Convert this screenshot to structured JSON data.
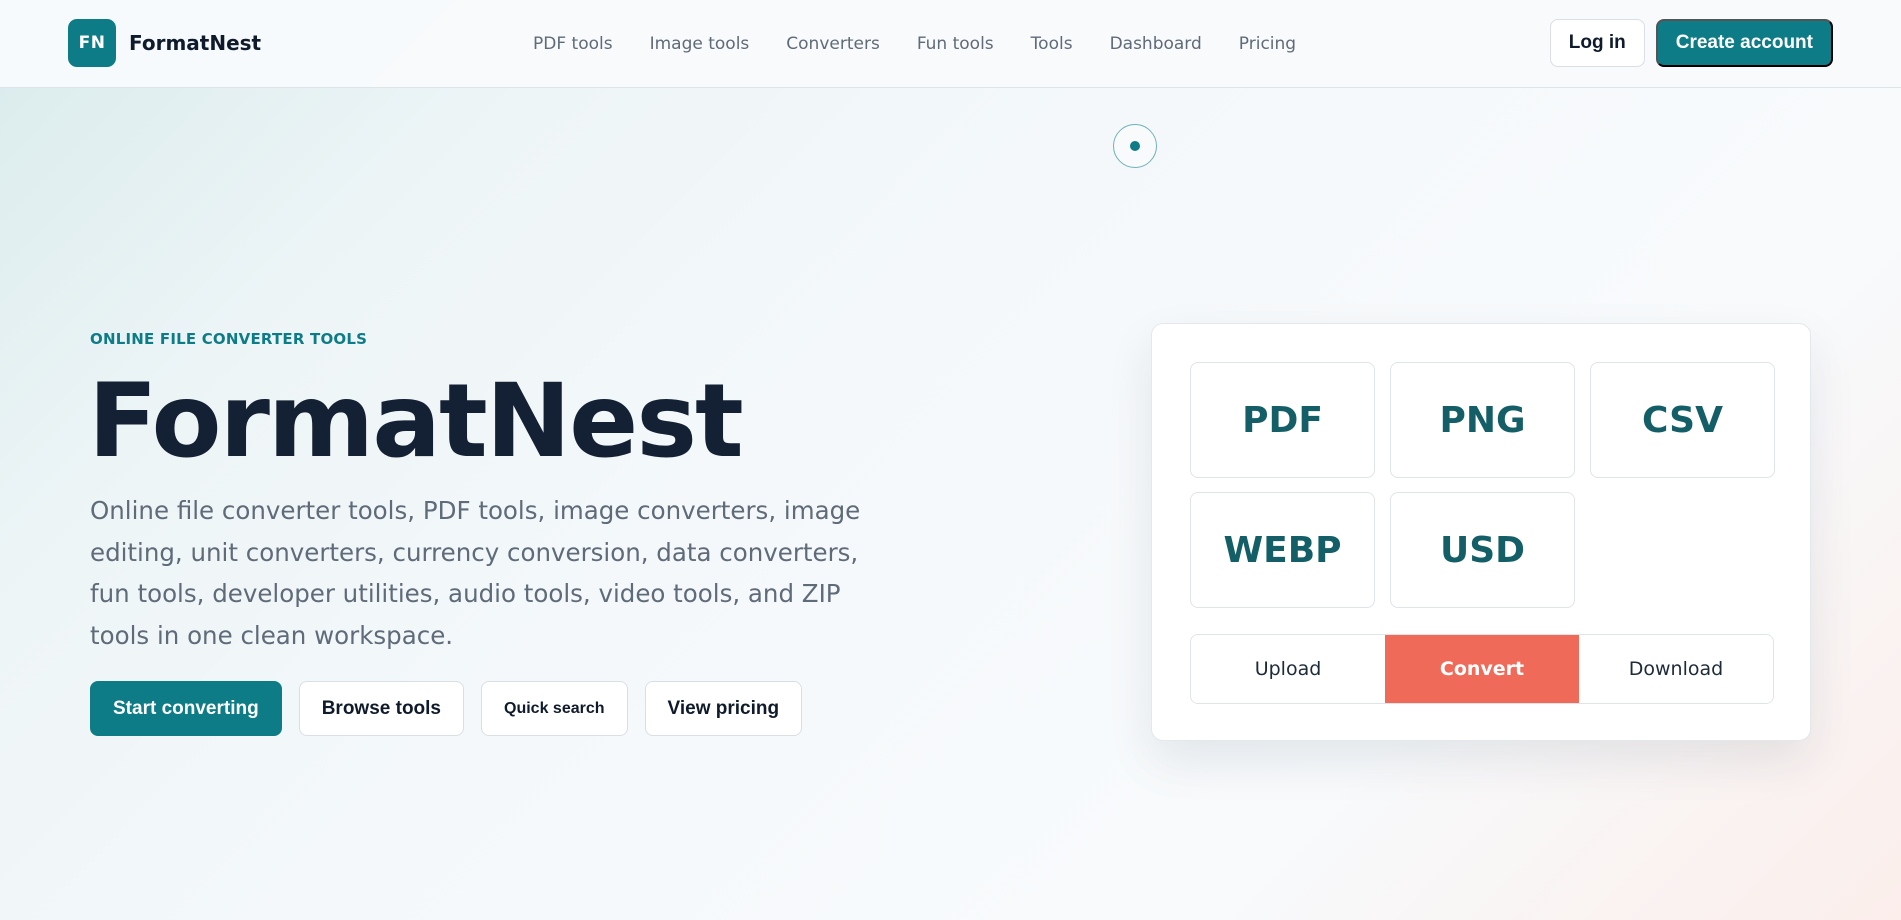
{
  "header": {
    "brand": {
      "mark": "FN",
      "name": "FormatNest"
    },
    "nav": [
      {
        "label": "PDF tools"
      },
      {
        "label": "Image tools"
      },
      {
        "label": "Converters"
      },
      {
        "label": "Fun tools"
      },
      {
        "label": "Tools"
      },
      {
        "label": "Dashboard"
      },
      {
        "label": "Pricing"
      }
    ],
    "login_label": "Log in",
    "create_label": "Create account"
  },
  "hero": {
    "eyebrow": "ONLINE FILE CONVERTER TOOLS",
    "title": "FormatNest",
    "description": "Online file converter tools, PDF tools, image converters, image editing, unit converters, currency conversion, data converters, fun tools, developer utilities, audio tools, video tools, and ZIP tools in one clean workspace.",
    "buttons": {
      "start": "Start converting",
      "browse": "Browse tools",
      "search": "Quick search",
      "pricing": "View pricing"
    }
  },
  "converter_card": {
    "formats": [
      {
        "label": "PDF"
      },
      {
        "label": "PNG"
      },
      {
        "label": "CSV"
      },
      {
        "label": "WEBP"
      },
      {
        "label": "USD"
      }
    ],
    "steps": [
      {
        "label": "Upload"
      },
      {
        "label": "Convert"
      },
      {
        "label": "Download"
      }
    ],
    "active_step": "Convert"
  },
  "colors": {
    "brand": "#0e7c86",
    "accent": "#f06a5a",
    "heading": "#142033",
    "muted_text": "#5f6b78",
    "format_text": "#145f67"
  },
  "icons": {
    "loader": "loading-ring-icon"
  }
}
